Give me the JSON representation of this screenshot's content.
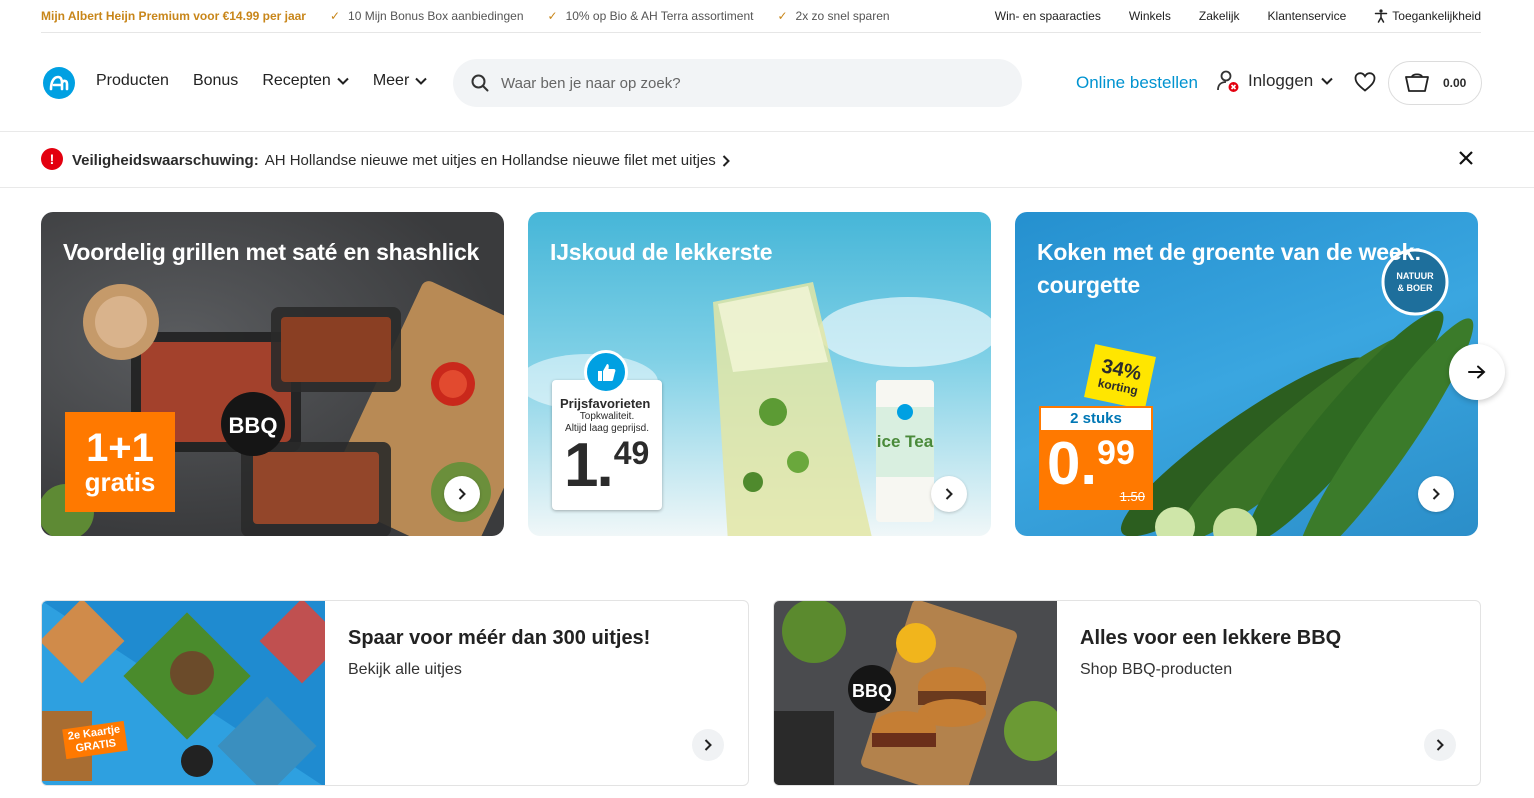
{
  "topbar": {
    "premium": "Mijn Albert Heijn Premium voor €14.99 per jaar",
    "usps": [
      "10 Mijn Bonus Box aanbiedingen",
      "10% op Bio & AH Terra assortiment",
      "2x zo snel sparen"
    ],
    "links": [
      "Win- en spaaracties",
      "Winkels",
      "Zakelijk",
      "Klantenservice"
    ],
    "accessibility": "Toegankelijkheid"
  },
  "header": {
    "nav": [
      "Producten",
      "Bonus",
      "Recepten",
      "Meer"
    ],
    "search_placeholder": "Waar ben je naar op zoek?",
    "online": "Online bestellen",
    "login": "Inloggen",
    "cart_total": "0.00"
  },
  "alert": {
    "label": "Veiligheidswaarschuwing:",
    "message": "AH Hollandse nieuwe met uitjes en Hollandse nieuwe filet met uitjes"
  },
  "heroes": [
    {
      "title": "Voordelig grillen met saté en shashlick",
      "badge_line1": "1+1",
      "badge_line2": "gratis",
      "tag": "BBQ"
    },
    {
      "title": "IJskoud de lekkerste",
      "price_label": "Prijsfavorieten",
      "price_sub1": "Topkwaliteit.",
      "price_sub2": "Altijd laag geprijsd.",
      "price_int": "1",
      "price_dec": "49",
      "product": "ice Tea"
    },
    {
      "title": "Koken met de groente van de week: courgette",
      "discount": "34%",
      "discount_label": "korting",
      "qty": "2 stuks",
      "price_int": "0",
      "price_dec": "99",
      "old_price": "1.50"
    }
  ],
  "promos": [
    {
      "title": "Spaar voor méér dan 300 uitjes!",
      "subtitle": "Bekijk alle uitjes",
      "badge": "2e Kaartje GRATIS"
    },
    {
      "title": "Alles voor een lekkere BBQ",
      "subtitle": "Shop BBQ-producten",
      "tag": "BBQ"
    }
  ],
  "colors": {
    "accent": "#00a0e2",
    "premium": "#c8861a",
    "alert": "#e3000f",
    "bonus_orange": "#ff7900"
  }
}
